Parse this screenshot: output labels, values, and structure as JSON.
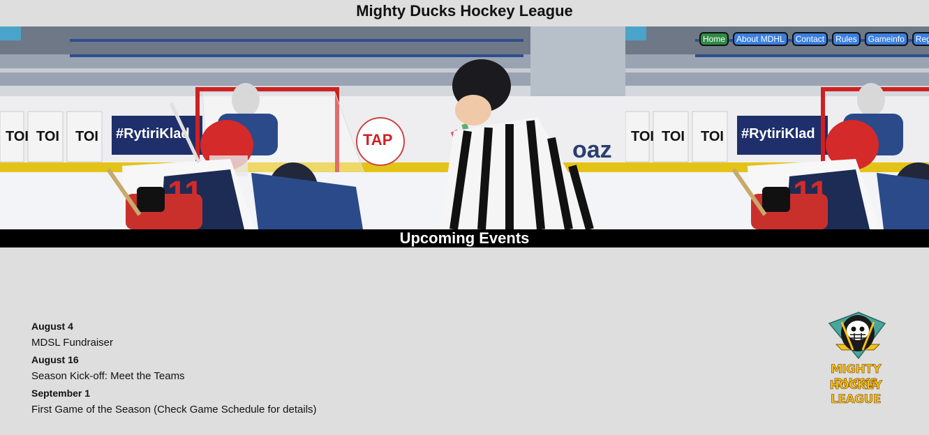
{
  "site": {
    "title": "Mighty Ducks Hockey League"
  },
  "nav": {
    "items": [
      {
        "label": "Home",
        "active": true
      },
      {
        "label": "About MDHL",
        "active": false
      },
      {
        "label": "Contact",
        "active": false
      },
      {
        "label": "Rules",
        "active": false
      },
      {
        "label": "Gameinfo",
        "active": false
      },
      {
        "label": "Register",
        "active": false
      }
    ]
  },
  "events": {
    "heading": "Upcoming Events",
    "items": [
      {
        "date": "August 4",
        "description": "MDSL Fundraiser"
      },
      {
        "date": "August 16",
        "description": "Season Kick-off: Meet the Teams"
      },
      {
        "date": "September 1",
        "description": "First Game of the Season (Check Game Schedule for details)"
      }
    ]
  },
  "banner_photo": {
    "board_ads": [
      "TOI TOI",
      "#RytiriKladno",
      "TAP",
      "oaz"
    ],
    "jersey_number": "11"
  },
  "logo": {
    "line1": "MIGHTY DUCKS",
    "line2": "HOCKEY LEAGUE"
  },
  "colors": {
    "page_bg": "#dedede",
    "nav_button": "#3b7fe0",
    "nav_button_active": "#2e8b46",
    "events_bar": "#000000",
    "logo_gold": "#f7c21b",
    "logo_teal": "#4aa59c"
  }
}
